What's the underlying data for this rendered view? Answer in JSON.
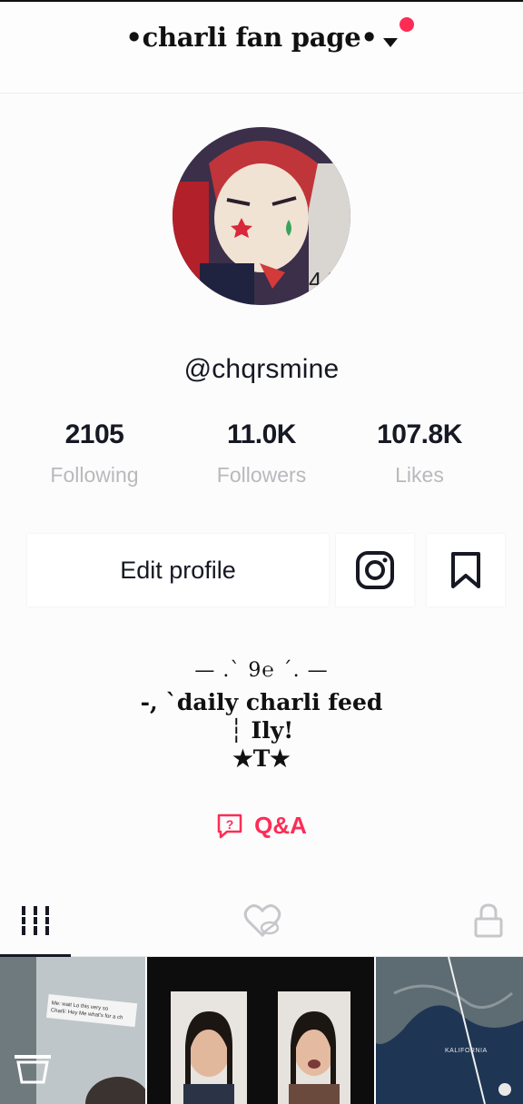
{
  "header": {
    "title": "•charli fan page•"
  },
  "profile": {
    "username": "@chqrsmine"
  },
  "stats": [
    {
      "value": "2105",
      "label": "Following"
    },
    {
      "value": "11.0K",
      "label": "Followers"
    },
    {
      "value": "107.8K",
      "label": "Likes"
    }
  ],
  "actions": {
    "edit_label": "Edit profile"
  },
  "bio": {
    "line1": "— .` 9℮ ´. —",
    "line2": "-, `daily charli feed",
    "line3": "┆ Ily!",
    "line4": "★T★"
  },
  "qa": {
    "label": "Q&A"
  },
  "thumbnails": [
    {
      "caption": "Me: wait Lo this very so\nCharli: Hey Me what's for a ch"
    },
    {
      "caption": ""
    },
    {
      "caption": "KALIFORNIA"
    }
  ],
  "colors": {
    "accent": "#fe2c55",
    "text": "#161823",
    "muted": "#b8b9bd"
  }
}
